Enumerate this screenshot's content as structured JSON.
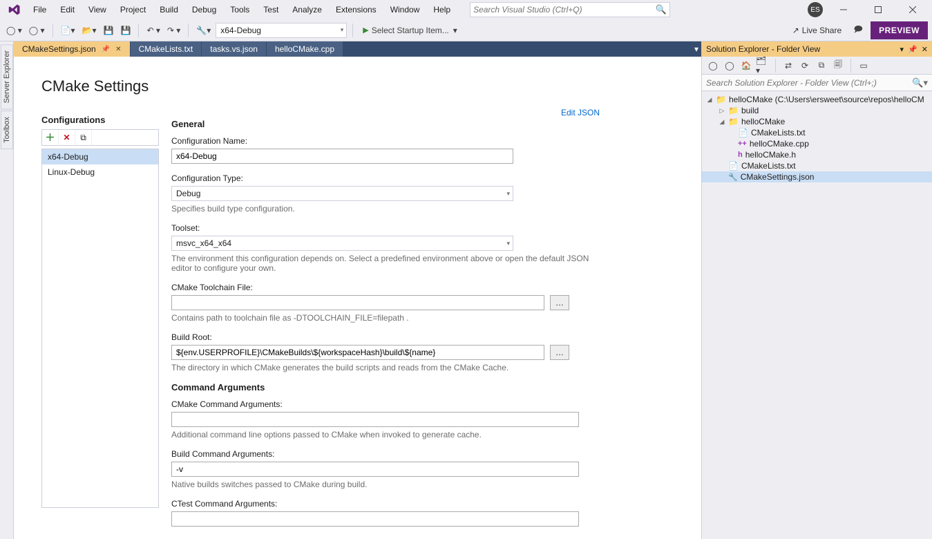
{
  "menubar": {
    "items": [
      "File",
      "Edit",
      "View",
      "Project",
      "Build",
      "Debug",
      "Tools",
      "Test",
      "Analyze",
      "Extensions",
      "Window",
      "Help"
    ],
    "search_placeholder": "Search Visual Studio (Ctrl+Q)",
    "avatar_initials": "ES"
  },
  "toolbar": {
    "config_combo": "x64-Debug",
    "startup_label": "Select Startup Item...",
    "live_share": "Live Share",
    "preview": "PREVIEW"
  },
  "doc_tabs": [
    {
      "label": "CMakeSettings.json",
      "active": true
    },
    {
      "label": "CMakeLists.txt",
      "active": false
    },
    {
      "label": "tasks.vs.json",
      "active": false
    },
    {
      "label": "helloCMake.cpp",
      "active": false
    }
  ],
  "left_docks": [
    "Server Explorer",
    "Toolbox"
  ],
  "cmake": {
    "title": "CMake Settings",
    "configurations_label": "Configurations",
    "configs": [
      "x64-Debug",
      "Linux-Debug"
    ],
    "edit_json": "Edit JSON",
    "sections": {
      "general": "General",
      "cmd_args": "Command Arguments"
    },
    "fields": {
      "config_name": {
        "label": "Configuration Name:",
        "value": "x64-Debug"
      },
      "config_type": {
        "label": "Configuration Type:",
        "value": "Debug",
        "helper": "Specifies build type configuration."
      },
      "toolset": {
        "label": "Toolset:",
        "value": "msvc_x64_x64",
        "helper": "The environment this configuration depends on. Select a predefined environment above or open the default JSON editor to configure your own."
      },
      "toolchain": {
        "label": "CMake Toolchain File:",
        "value": "",
        "helper": "Contains path to toolchain file as -DTOOLCHAIN_FILE=filepath ."
      },
      "build_root": {
        "label": "Build Root:",
        "value": "${env.USERPROFILE}\\CMakeBuilds\\${workspaceHash}\\build\\${name}",
        "helper": "The directory in which CMake generates the build scripts and reads from the CMake Cache."
      },
      "cmake_args": {
        "label": "CMake Command Arguments:",
        "value": "",
        "helper": "Additional command line options passed to CMake when invoked to generate cache."
      },
      "build_args": {
        "label": "Build Command Arguments:",
        "value": "-v",
        "helper": "Native builds switches passed to CMake during build."
      },
      "ctest_args": {
        "label": "CTest Command Arguments:",
        "value": ""
      }
    }
  },
  "sol_explorer": {
    "title": "Solution Explorer - Folder View",
    "search_placeholder": "Search Solution Explorer - Folder View (Ctrl+;)",
    "root": "helloCMake (C:\\Users\\ersweet\\source\\repos\\helloCM",
    "tree": {
      "build": "build",
      "helloCMake": "helloCMake",
      "cmakelists_inner": "CMakeLists.txt",
      "hello_cpp": "helloCMake.cpp",
      "hello_h": "helloCMake.h",
      "cmakelists": "CMakeLists.txt",
      "cmakesettings": "CMakeSettings.json"
    }
  }
}
